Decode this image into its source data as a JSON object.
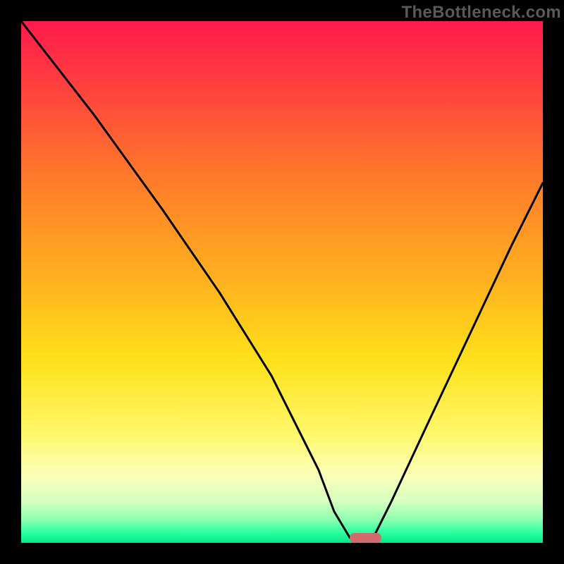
{
  "watermark": "TheBottleneck.com",
  "colors": {
    "frame": "#000000",
    "watermark": "#595959",
    "curve": "#000000",
    "marker_fill": "#d16a6a",
    "gradient_stops": [
      {
        "offset": 0.0,
        "color": "#ff1a4b"
      },
      {
        "offset": 0.12,
        "color": "#ff3f3f"
      },
      {
        "offset": 0.3,
        "color": "#ff7a2a"
      },
      {
        "offset": 0.5,
        "color": "#ffb21f"
      },
      {
        "offset": 0.65,
        "color": "#ffe11a"
      },
      {
        "offset": 0.79,
        "color": "#fff76a"
      },
      {
        "offset": 0.87,
        "color": "#fbffb8"
      },
      {
        "offset": 0.92,
        "color": "#d6ffc0"
      },
      {
        "offset": 0.955,
        "color": "#8dffb0"
      },
      {
        "offset": 0.98,
        "color": "#2dffa0"
      },
      {
        "offset": 1.0,
        "color": "#00e88a"
      }
    ]
  },
  "chart_data": {
    "type": "line",
    "title": "",
    "xlabel": "",
    "ylabel": "",
    "xlim": [
      0,
      100
    ],
    "ylim": [
      0,
      100
    ],
    "grid": false,
    "legend": false,
    "series": [
      {
        "name": "bottleneck-curve",
        "x": [
          0,
          14,
          27,
          38,
          48,
          57,
          60,
          63,
          65,
          67,
          71,
          78,
          86,
          94,
          100
        ],
        "y": [
          100,
          82,
          64,
          48,
          32,
          14,
          6,
          1,
          0,
          0,
          8,
          23,
          40,
          57,
          69
        ]
      }
    ],
    "marker": {
      "x_center": 66,
      "y": 0,
      "half_width": 3
    }
  }
}
